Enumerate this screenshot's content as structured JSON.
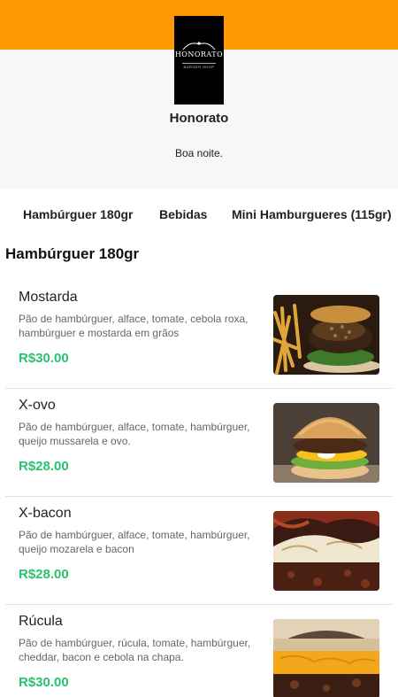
{
  "colors": {
    "brand": "#ff9800",
    "price": "#27c36f",
    "hero_bg": "#f7f7f9"
  },
  "store": {
    "logo_icon": "honorato-logo",
    "logo_text": "HONORATO",
    "logo_subtext": "BURGER SHOP",
    "name": "Honorato",
    "greeting": "Boa noite."
  },
  "categories": [
    {
      "label": "Hambúrguer 180gr"
    },
    {
      "label": "Bebidas"
    },
    {
      "label": "Mini Hamburgueres (115gr)"
    }
  ],
  "section": {
    "title": "Hambúrguer 180gr"
  },
  "items": [
    {
      "name": "Mostarda",
      "description": "Pão de hambúrguer, alface, tomate, cebola roxa, hambúrguer e mostarda em grãos",
      "price": "R$30.00",
      "image_icon": "burger-photo-mostarda"
    },
    {
      "name": "X-ovo",
      "description": "Pão de hambúrguer, alface, tomate, hambúrguer, queijo mussarela e ovo.",
      "price": "R$28.00",
      "image_icon": "burger-photo-x-ovo"
    },
    {
      "name": "X-bacon",
      "description": "Pão de hambúrguer, alface, tomate, hambúrguer, queijo mozarela e bacon",
      "price": "R$28.00",
      "image_icon": "burger-photo-x-bacon"
    },
    {
      "name": "Rúcula",
      "description": "Pão de hambúrguer, rúcula, tomate, hambúrguer, cheddar, bacon e cebola na chapa.",
      "price": "R$30.00",
      "image_icon": "burger-photo-rucula"
    }
  ]
}
